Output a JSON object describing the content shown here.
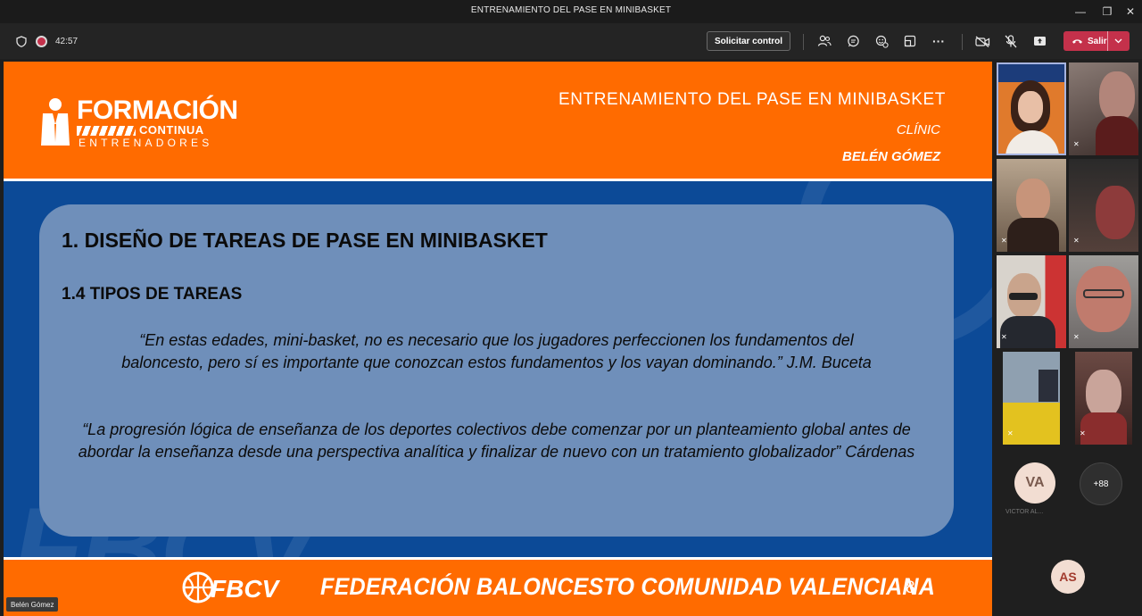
{
  "window": {
    "title": "ENTRENAMIENTO DEL PASE EN MINIBASKET"
  },
  "toolbar": {
    "timer": "42:57",
    "request_control": "Solicitar control",
    "leave": "Salir"
  },
  "slide": {
    "logo_line1": "FORMACIÓN",
    "logo_line2": "CONTINUA",
    "logo_line3": "ENTRENADORES",
    "title": "ENTRENAMIENTO DEL PASE EN MINIBASKET",
    "subtitle1": "CLÍNIC",
    "subtitle2": "BELÉN GÓMEZ",
    "heading1": "1. DISEÑO DE TAREAS DE PASE EN MINIBASKET",
    "heading2": "1.4 TIPOS DE TAREAS",
    "quote1": "“En estas edades, mini-basket, no es necesario que los jugadores perfeccionen los fundamentos del baloncesto, pero sí es importante que conozcan estos fundamentos y los vayan dominando.” J.M. Buceta",
    "quote2": "“La progresión lógica de enseñanza de los deportes colectivos debe comenzar por un planteamiento global antes de abordar la enseñanza desde una perspectiva analítica y finalizar de nuevo con un tratamiento globalizador” Cárdenas",
    "watermark": "FBCV",
    "footer_logo": "FBCV",
    "footer_text": "FEDERACIÓN BALONCESTO COMUNIDAD VALENCIANA",
    "page_number": "8"
  },
  "presenter": {
    "name": "Belén Gómez"
  },
  "participants": {
    "va_initials": "VA",
    "va_name": "VICTOR AL...",
    "overflow": "+88",
    "as_initials": "AS"
  },
  "colors": {
    "orange": "#ff6b00",
    "blue": "#0c4a97",
    "leave_red": "#c4314b"
  }
}
